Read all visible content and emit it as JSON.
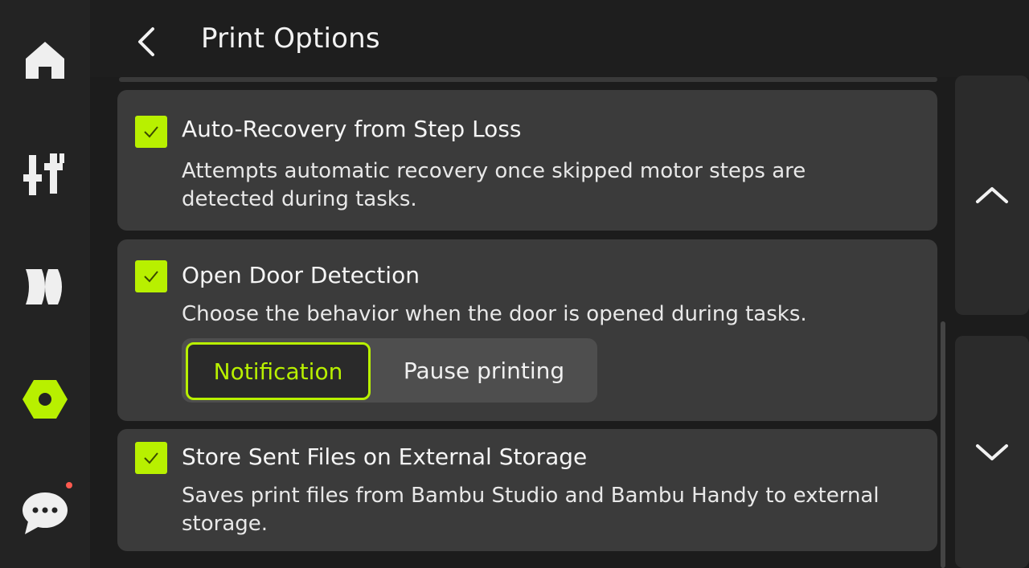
{
  "header": {
    "title": "Print Options"
  },
  "nav": {
    "items": [
      {
        "icon": "home-icon"
      },
      {
        "icon": "controls-icon"
      },
      {
        "icon": "filament-icon"
      },
      {
        "icon": "settings-icon",
        "active": true
      },
      {
        "icon": "messages-icon",
        "has_notification": true
      }
    ],
    "active_color": "#b8f000",
    "notification_color": "#ff5a4f"
  },
  "options": [
    {
      "title": "Auto-Recovery from Step Loss",
      "description": "Attempts automatic recovery once skipped motor steps are detected during tasks.",
      "checked": true
    },
    {
      "title": "Open Door Detection",
      "description": "Choose the behavior when the door is opened during tasks.",
      "checked": true,
      "choices": [
        "Notification",
        "Pause printing"
      ],
      "selected_choice": "Notification"
    },
    {
      "title": "Store Sent Files on External Storage",
      "description": "Saves print files from Bambu Studio and Bambu Handy to external storage.",
      "checked": true
    }
  ],
  "scroll": {
    "up_icon": "chevron-up-icon",
    "down_icon": "chevron-down-icon"
  },
  "colors": {
    "accent": "#b8f000",
    "card_bg": "#3b3b3b",
    "screen_bg": "#1c1c1c"
  }
}
